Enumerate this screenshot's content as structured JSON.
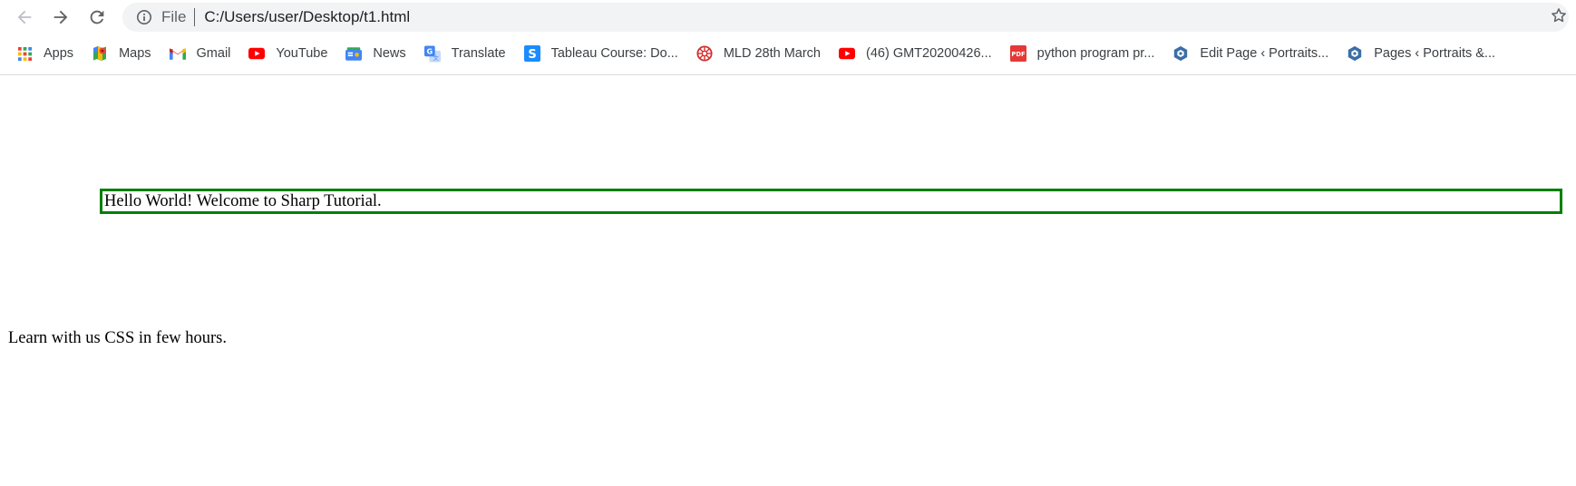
{
  "browser": {
    "address_bar": {
      "scheme_label": "File",
      "url": "C:/Users/user/Desktop/t1.html"
    },
    "nav_icons": [
      "back-arrow-icon",
      "forward-arrow-icon",
      "reload-icon"
    ],
    "bookmarks": [
      {
        "label": "Apps",
        "icon": "apps-grid-icon"
      },
      {
        "label": "Maps",
        "icon": "google-maps-icon"
      },
      {
        "label": "Gmail",
        "icon": "gmail-icon"
      },
      {
        "label": "YouTube",
        "icon": "youtube-icon"
      },
      {
        "label": "News",
        "icon": "google-news-icon"
      },
      {
        "label": "Translate",
        "icon": "google-translate-icon"
      },
      {
        "label": "Tableau Course: Do...",
        "icon": "skillshare-s-icon"
      },
      {
        "label": "MLD 28th March",
        "icon": "red-wheel-icon"
      },
      {
        "label": "(46) GMT20200426...",
        "icon": "youtube-icon"
      },
      {
        "label": "python program pr...",
        "icon": "pdf-icon"
      },
      {
        "label": "Edit Page ‹ Portraits...",
        "icon": "hexagon-logo-icon"
      },
      {
        "label": "Pages ‹ Portraits &...",
        "icon": "hexagon-logo-icon"
      }
    ]
  },
  "page": {
    "hello_text": "Hello World! Welcome to Sharp Tutorial.",
    "learn_text": "Learn with us CSS in few hours."
  },
  "colors": {
    "box_border": "#008000",
    "omnibox_bg": "#f1f3f4"
  }
}
